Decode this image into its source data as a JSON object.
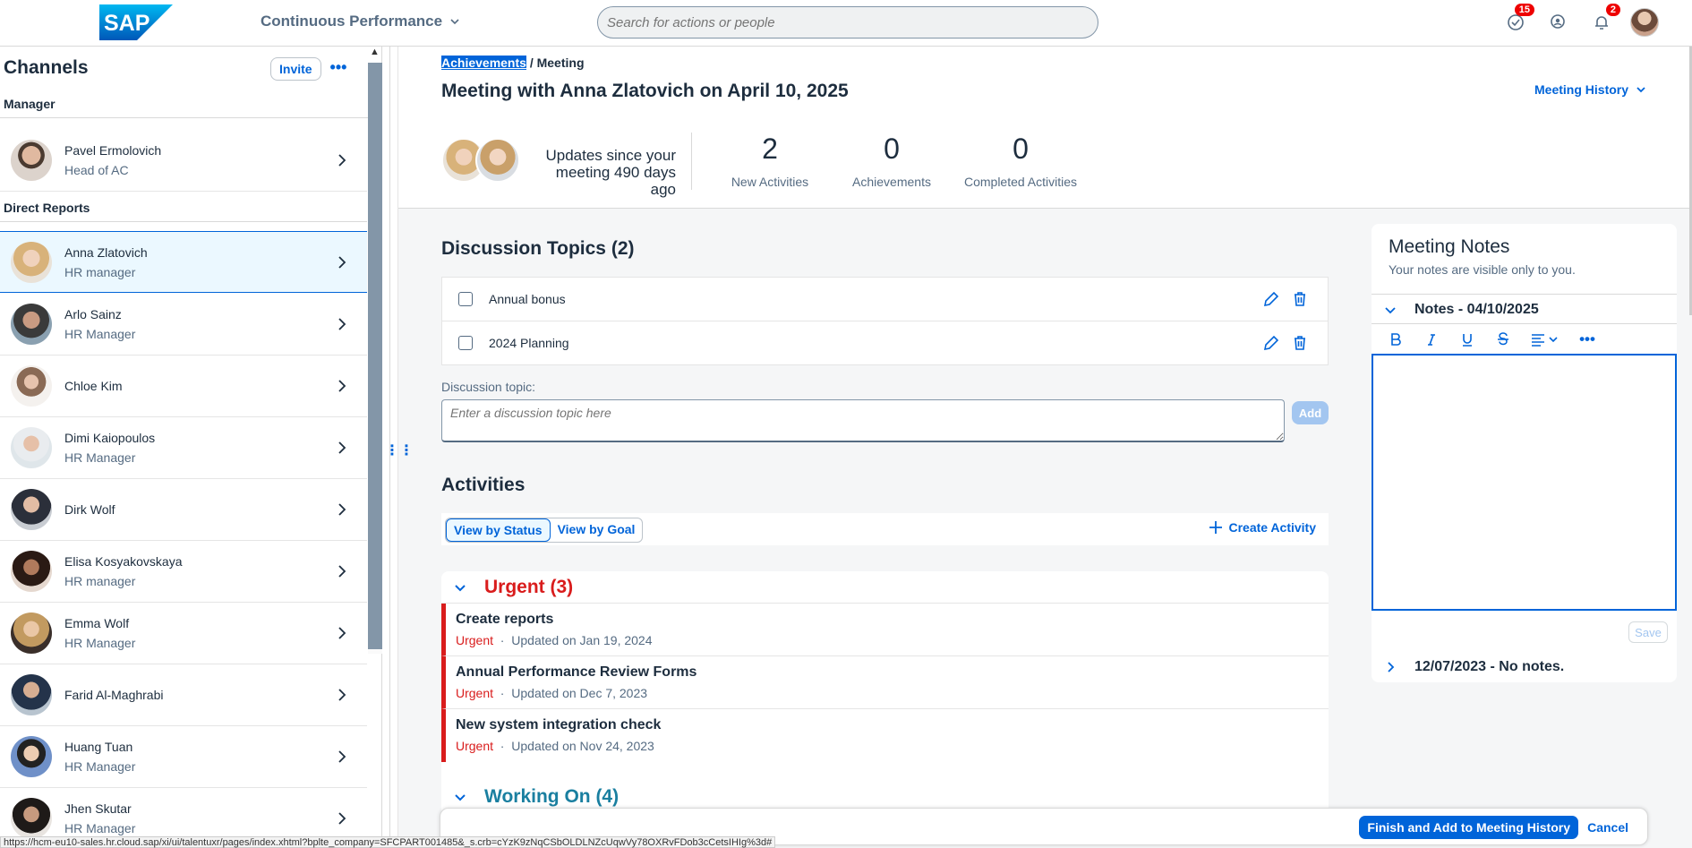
{
  "shell": {
    "app_title": "Continuous Performance",
    "search_placeholder": "Search for actions or people",
    "todo_badge": "15",
    "notif_badge": "2",
    "logo_text": "SAP"
  },
  "sidebar": {
    "title": "Channels",
    "invite_label": "Invite",
    "manager_label": "Manager",
    "manager": {
      "name": "Pavel Ermolovich",
      "role": "Head of AC"
    },
    "direct_label": "Direct Reports",
    "reports": [
      {
        "name": "Anna Zlatovich",
        "role": "HR manager"
      },
      {
        "name": "Arlo Sainz",
        "role": "HR Manager"
      },
      {
        "name": "Chloe Kim",
        "role": ""
      },
      {
        "name": "Dimi Kaiopoulos",
        "role": "HR Manager"
      },
      {
        "name": "Dirk Wolf",
        "role": ""
      },
      {
        "name": "Elisa Kosyakovskaya",
        "role": "HR manager"
      },
      {
        "name": "Emma Wolf",
        "role": "HR Manager"
      },
      {
        "name": "Farid Al-Maghrabi",
        "role": ""
      },
      {
        "name": "Huang Tuan",
        "role": "HR Manager"
      },
      {
        "name": "Jhen Skutar",
        "role": "HR Manager"
      }
    ]
  },
  "header": {
    "breadcrumb_link": "Achievements",
    "breadcrumb_current": "Meeting",
    "title": "Meeting with Anna Zlatovich on April 10, 2025",
    "history_label": "Meeting History",
    "updates_text": "Updates since your meeting 490 days ago",
    "kpis": [
      {
        "value": "2",
        "label": "New Activities"
      },
      {
        "value": "0",
        "label": "Achievements"
      },
      {
        "value": "0",
        "label": "Completed Activities"
      }
    ]
  },
  "topics": {
    "title": "Discussion Topics (2)",
    "items": [
      "Annual bonus",
      "2024 Planning"
    ],
    "field_label": "Discussion topic:",
    "field_placeholder": "Enter a discussion topic here",
    "add_label": "Add"
  },
  "activities": {
    "title": "Activities",
    "view_status": "View by Status",
    "view_goal": "View by Goal",
    "create_label": "Create Activity",
    "urgent_title": "Urgent (3)",
    "urgent_items": [
      {
        "title": "Create reports",
        "status": "Urgent",
        "updated": "Updated on Jan 19, 2024"
      },
      {
        "title": "Annual Performance Review Forms",
        "status": "Urgent",
        "updated": "Updated on Dec 7, 2023"
      },
      {
        "title": "New system integration check",
        "status": "Urgent",
        "updated": "Updated on Nov 24, 2023"
      }
    ],
    "working_title": "Working On (4)"
  },
  "notes": {
    "title": "Meeting Notes",
    "subtitle": "Your notes are visible only to you.",
    "current_section": "Notes - 04/10/2025",
    "prev_section": "12/07/2023 - No notes.",
    "save_label": "Save"
  },
  "footer": {
    "finish_label": "Finish and Add to Meeting History",
    "cancel_label": "Cancel"
  },
  "status_url": "https://hcm-eu10-sales.hr.cloud.sap/xi/ui/talentuxr/pages/index.xhtml?bplte_company=SFCPART001485&_s.crb=cYzK9zNqCSbOLDLNZcUqwVy78OXRvFDob3cCetsIHIg%3d#",
  "colors": {
    "accent": "#0064d9",
    "urgent": "#d91c1c",
    "working": "#1a7fa0"
  }
}
